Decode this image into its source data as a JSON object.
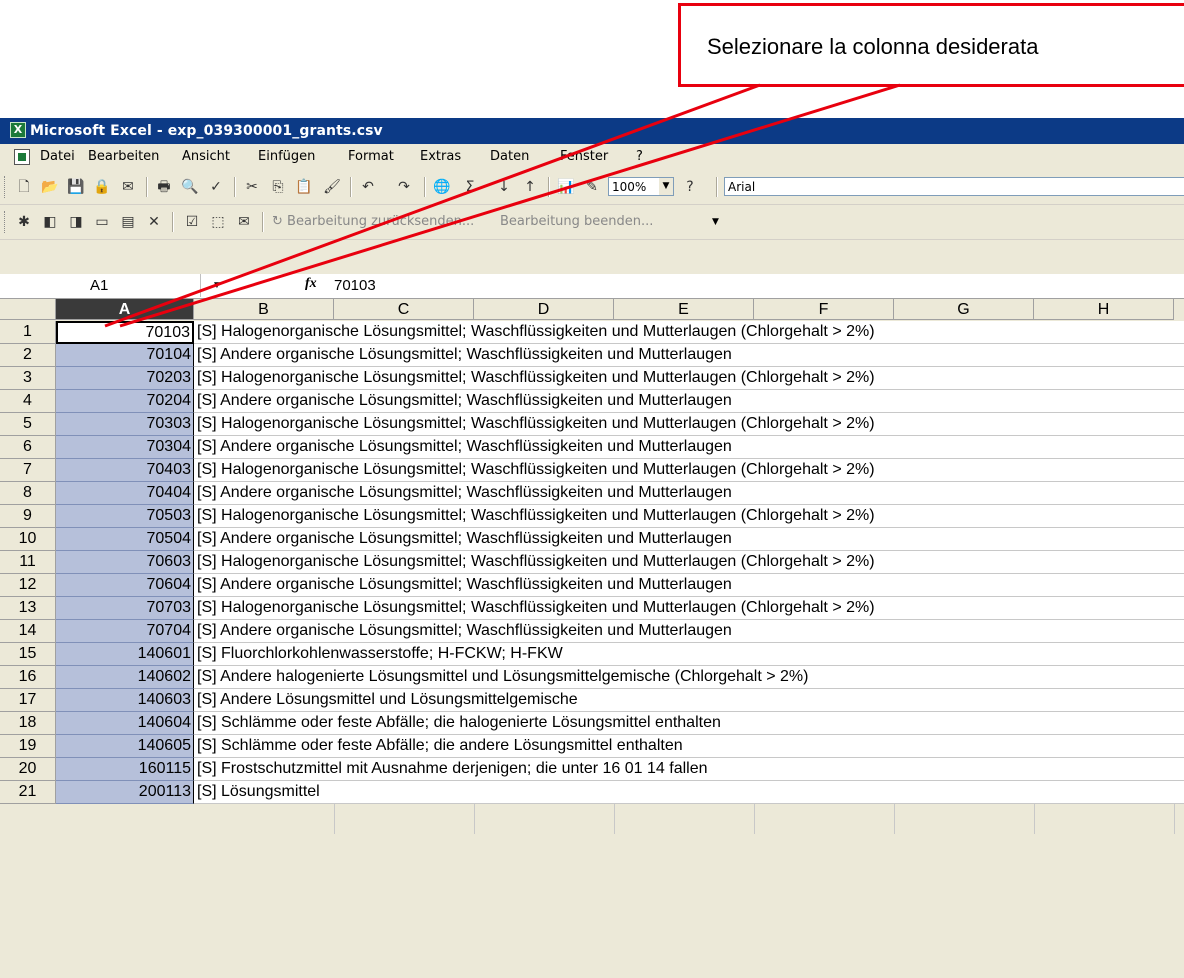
{
  "callout": {
    "text": "Selezionare la colonna desiderata"
  },
  "colors": {
    "callout_border": "#e8000e",
    "selection": "#b6c0da",
    "titlebar": "#0c3a86"
  },
  "window": {
    "title": "Microsoft Excel - exp_039300001_grants.csv"
  },
  "menu": [
    "Datei",
    "Bearbeiten",
    "Ansicht",
    "Einfügen",
    "Format",
    "Extras",
    "Daten",
    "Fenster",
    "?"
  ],
  "toolbar": {
    "zoom": "100%",
    "font": "Arial",
    "review_send": "Bearbeitung zurücksenden...",
    "review_end": "Bearbeitung beenden..."
  },
  "formula_bar": {
    "name_box": "A1",
    "fx": "fx",
    "value": "70103"
  },
  "columns": [
    "A",
    "B",
    "C",
    "D",
    "E",
    "F",
    "G",
    "H"
  ],
  "rows": [
    {
      "n": "1",
      "a": "70103",
      "b": "[S] Halogenorganische Lösungsmittel; Waschflüssigkeiten und Mutterlaugen (Chlorgehalt > 2%)"
    },
    {
      "n": "2",
      "a": "70104",
      "b": "[S] Andere organische Lösungsmittel; Waschflüssigkeiten und Mutterlaugen"
    },
    {
      "n": "3",
      "a": "70203",
      "b": "[S] Halogenorganische Lösungsmittel; Waschflüssigkeiten und Mutterlaugen (Chlorgehalt > 2%)"
    },
    {
      "n": "4",
      "a": "70204",
      "b": "[S] Andere organische Lösungsmittel; Waschflüssigkeiten und Mutterlaugen"
    },
    {
      "n": "5",
      "a": "70303",
      "b": "[S] Halogenorganische Lösungsmittel; Waschflüssigkeiten und Mutterlaugen (Chlorgehalt > 2%)"
    },
    {
      "n": "6",
      "a": "70304",
      "b": "[S] Andere organische Lösungsmittel; Waschflüssigkeiten und Mutterlaugen"
    },
    {
      "n": "7",
      "a": "70403",
      "b": "[S] Halogenorganische Lösungsmittel; Waschflüssigkeiten und Mutterlaugen (Chlorgehalt > 2%)"
    },
    {
      "n": "8",
      "a": "70404",
      "b": "[S] Andere organische Lösungsmittel; Waschflüssigkeiten und Mutterlaugen"
    },
    {
      "n": "9",
      "a": "70503",
      "b": "[S] Halogenorganische Lösungsmittel; Waschflüssigkeiten und Mutterlaugen (Chlorgehalt > 2%)"
    },
    {
      "n": "10",
      "a": "70504",
      "b": "[S] Andere organische Lösungsmittel; Waschflüssigkeiten und Mutterlaugen"
    },
    {
      "n": "11",
      "a": "70603",
      "b": "[S] Halogenorganische Lösungsmittel; Waschflüssigkeiten und Mutterlaugen (Chlorgehalt > 2%)"
    },
    {
      "n": "12",
      "a": "70604",
      "b": "[S] Andere organische Lösungsmittel; Waschflüssigkeiten und Mutterlaugen"
    },
    {
      "n": "13",
      "a": "70703",
      "b": "[S] Halogenorganische Lösungsmittel; Waschflüssigkeiten und Mutterlaugen (Chlorgehalt > 2%)"
    },
    {
      "n": "14",
      "a": "70704",
      "b": "[S] Andere organische Lösungsmittel; Waschflüssigkeiten und Mutterlaugen"
    },
    {
      "n": "15",
      "a": "140601",
      "b": "[S] Fluorchlorkohlenwasserstoffe; H-FCKW; H-FKW"
    },
    {
      "n": "16",
      "a": "140602",
      "b": "[S] Andere halogenierte Lösungsmittel und Lösungsmittelgemische (Chlorgehalt > 2%)"
    },
    {
      "n": "17",
      "a": "140603",
      "b": "[S] Andere Lösungsmittel und Lösungsmittelgemische"
    },
    {
      "n": "18",
      "a": "140604",
      "b": "[S] Schlämme oder feste Abfälle; die halogenierte Lösungsmittel enthalten"
    },
    {
      "n": "19",
      "a": "140605",
      "b": "[S] Schlämme oder feste Abfälle; die andere Lösungsmittel enthalten"
    },
    {
      "n": "20",
      "a": "160115",
      "b": "[S] Frostschutzmittel mit Ausnahme derjenigen; die unter 16 01 14 fallen"
    },
    {
      "n": "21",
      "a": "200113",
      "b": "[S] Lösungsmittel"
    }
  ]
}
